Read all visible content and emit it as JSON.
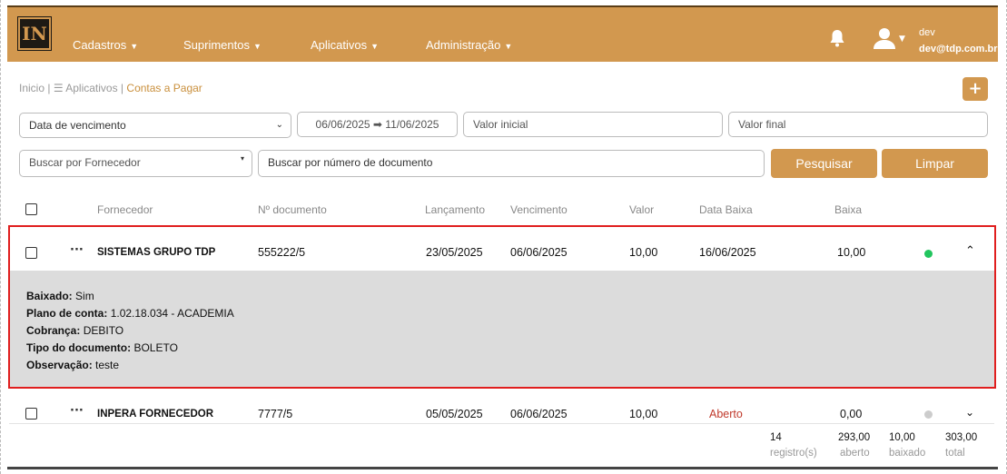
{
  "nav": {
    "logo_text": "IN",
    "menu": [
      "Cadastros",
      "Suprimentos",
      "Aplicativos",
      "Administração"
    ],
    "user_name": "dev",
    "user_email": "dev@tdp.com.br"
  },
  "breadcrumb": {
    "home": "Inicio |",
    "apps": "☰ Aplicativos |",
    "current": "Contas a Pagar"
  },
  "add_button": "+",
  "filters": {
    "date_type": "Data de vencimento",
    "date_range": "06/06/2025 ➡ 11/06/2025",
    "valor_inicial_placeholder": "Valor inicial",
    "valor_final_placeholder": "Valor final",
    "fornecedor_placeholder": "Buscar por Fornecedor",
    "documento_placeholder": "Buscar por número de documento",
    "search_label": "Pesquisar",
    "clear_label": "Limpar"
  },
  "table": {
    "headers": [
      "Fornecedor",
      "Nº documento",
      "Lançamento",
      "Vencimento",
      "Valor",
      "Data Baixa",
      "Baixa"
    ],
    "rows": [
      {
        "fornecedor": "SISTEMAS GRUPO TDP",
        "documento": "555222/5",
        "lancamento": "23/05/2025",
        "vencimento": "06/06/2025",
        "valor": "10,00",
        "data_baixa": "16/06/2025",
        "baixa": "10,00",
        "status_color": "#22c55e",
        "expanded": true,
        "details": {
          "baixado_label": "Baixado:",
          "baixado": "Sim",
          "plano_label": "Plano de conta:",
          "plano": "1.02.18.034 - ACADEMIA",
          "cobranca_label": "Cobrança:",
          "cobranca": "DEBITO",
          "tipo_label": "Tipo do documento:",
          "tipo": "BOLETO",
          "obs_label": "Observação:",
          "obs": "teste"
        }
      },
      {
        "fornecedor": "INPERA FORNECEDOR",
        "documento": "7777/5",
        "lancamento": "05/05/2025",
        "vencimento": "06/06/2025",
        "valor": "10,00",
        "data_baixa": "Aberto",
        "baixa": "0,00",
        "status_color": "#cccccc",
        "expanded": false
      }
    ]
  },
  "summary": {
    "registros": "14",
    "registros_label": "registro(s)",
    "aberto": "293,00",
    "aberto_label": "aberto",
    "baixado": "10,00",
    "baixado_label": "baixado",
    "total": "303,00",
    "total_label": "total"
  },
  "colors": {
    "brand": "#d2984f",
    "highlight_border": "#e01e1e",
    "open_status": "#c0392b"
  }
}
